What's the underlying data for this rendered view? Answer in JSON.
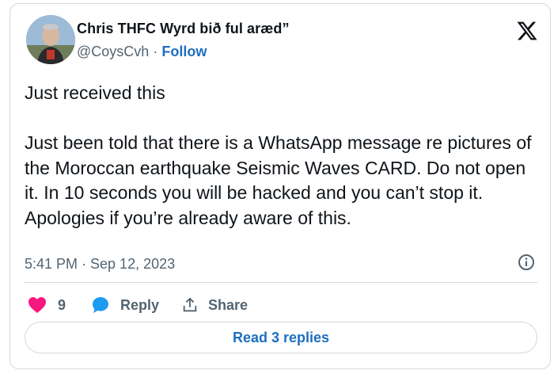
{
  "author": {
    "display_name": "Chris THFC Wyrd bið ful aræd”",
    "handle": "@CoysCvh",
    "separator": "·",
    "follow_label": "Follow"
  },
  "tweet": {
    "text": "Just received this\n\nJust been told that there is a WhatsApp message re pictures of the Moroccan earthquake Seismic Waves CARD. Do not open it. In 10 seconds you will be hacked and you can’t stop it. Apologies if you’re already aware of this.",
    "timestamp": "5:41 PM · Sep 12, 2023"
  },
  "actions": {
    "like_count": "9",
    "reply_label": "Reply",
    "share_label": "Share"
  },
  "footer": {
    "read_replies_label": "Read 3 replies"
  },
  "icons": [
    "avatar",
    "x-logo-icon",
    "info-icon",
    "heart-icon",
    "reply-bubble-icon",
    "share-icon"
  ],
  "colors": {
    "accent": "#1d6fbf",
    "heart": "#f91880",
    "muted": "#536471",
    "border": "#cfd9de"
  }
}
